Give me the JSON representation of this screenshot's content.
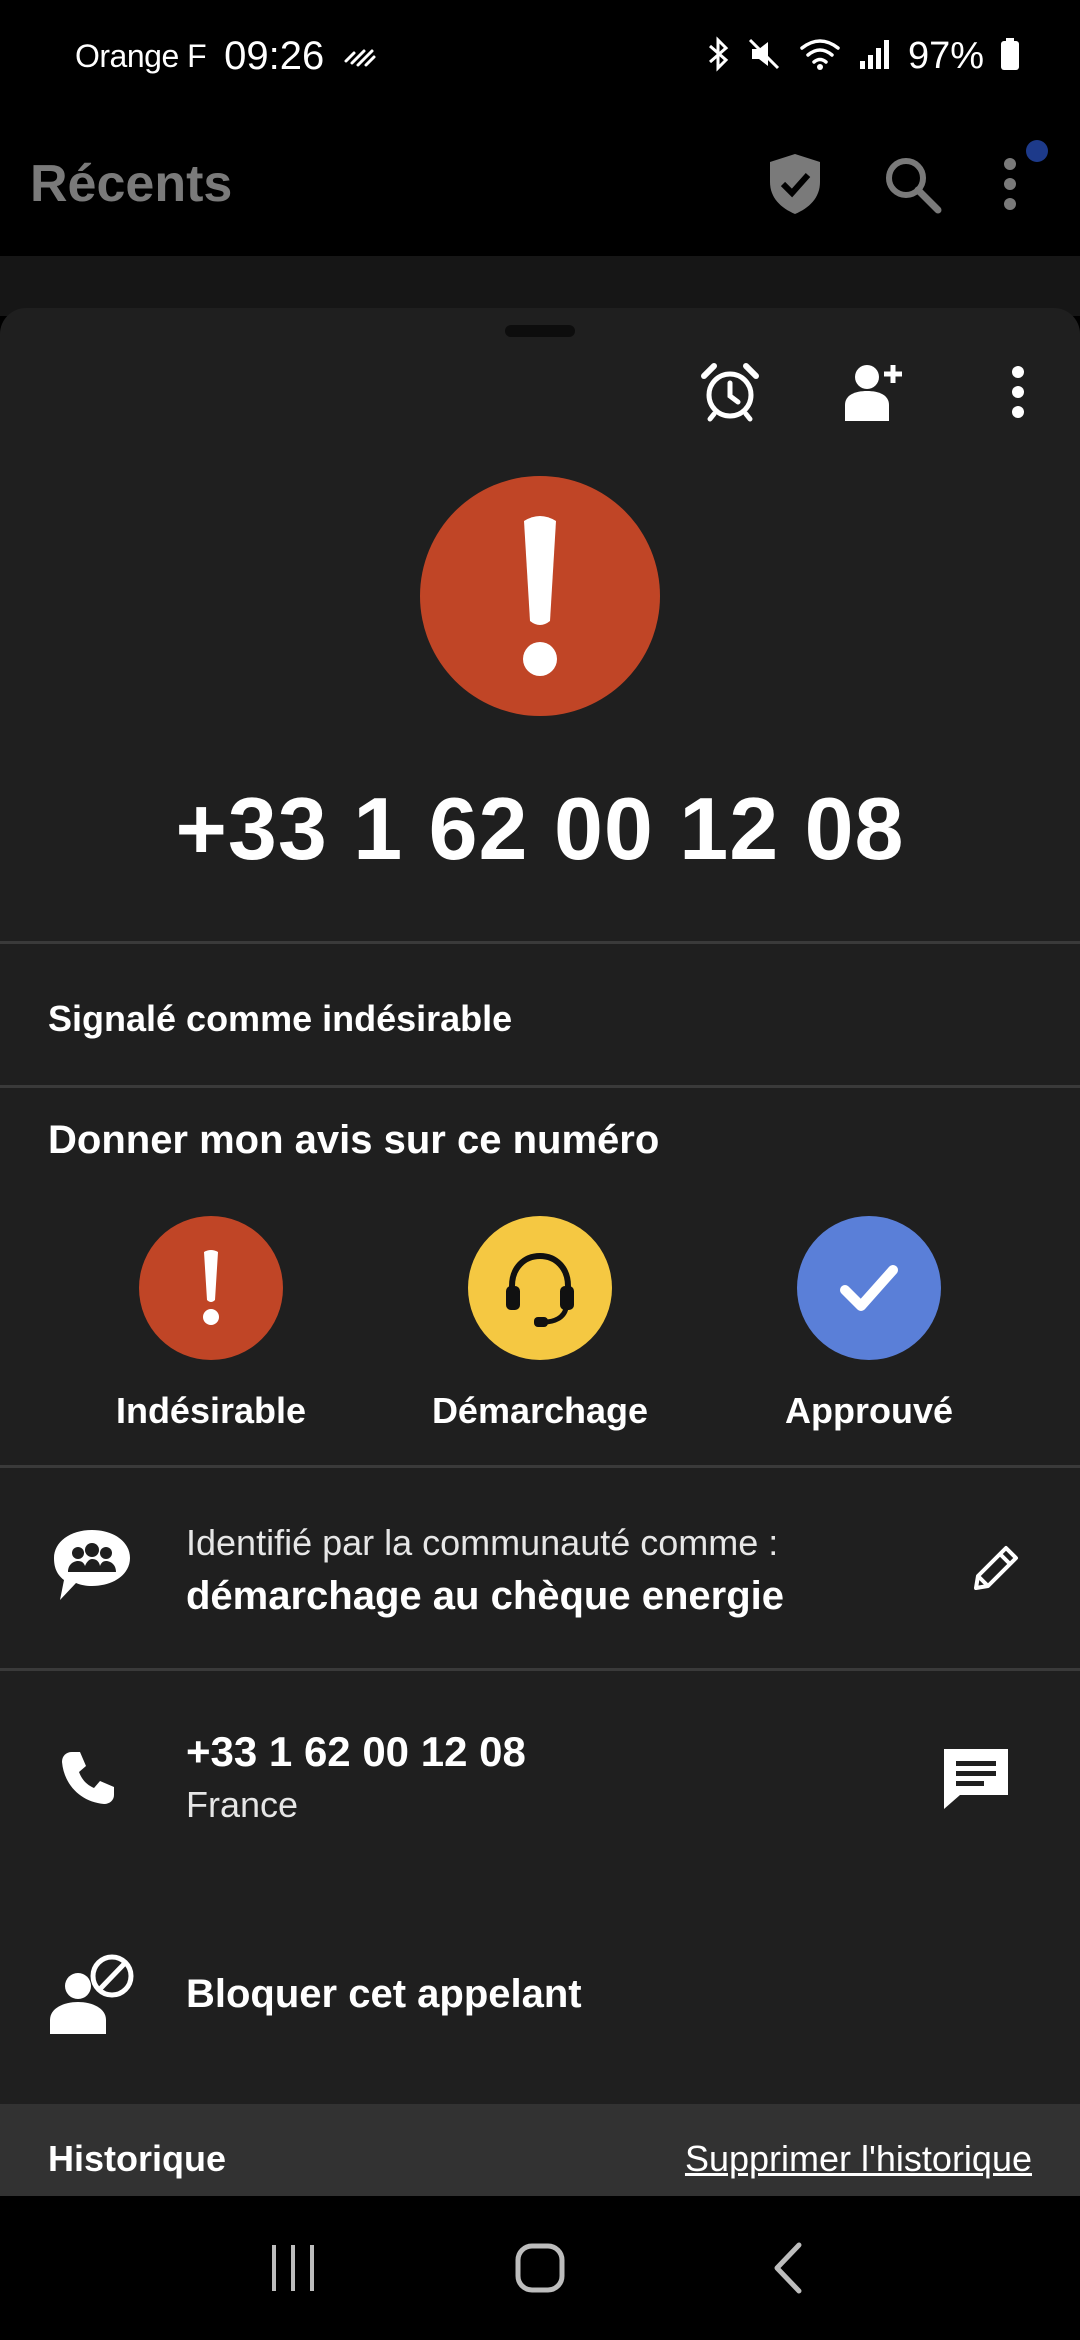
{
  "status_bar": {
    "carrier": "Orange F",
    "time": "09:26",
    "battery_percent": "97%",
    "icons": [
      "nfc-icon",
      "bluetooth-icon",
      "mute-icon",
      "wifi-icon",
      "signal-icon",
      "battery-icon"
    ]
  },
  "app_bar": {
    "title": "Récents",
    "icons": [
      "shield-check-icon",
      "search-icon",
      "more-vert-icon"
    ]
  },
  "sheet": {
    "actions": [
      "alarm-icon",
      "add-contact-icon",
      "more-vert-icon"
    ],
    "alert_color": "#c04526",
    "phone_number": "+33 1 62 00 12 08",
    "reported_text": "Signalé comme indésirable",
    "rate": {
      "title": "Donner mon avis sur ce numéro",
      "options": [
        {
          "label": "Indésirable",
          "color": "#c04526",
          "icon": "exclamation-icon"
        },
        {
          "label": "Démarchage",
          "color": "#f5c842",
          "icon": "headset-icon"
        },
        {
          "label": "Approuvé",
          "color": "#5a7fd8",
          "icon": "check-icon"
        }
      ]
    },
    "community": {
      "line1": "Identifié par la communauté comme :",
      "line2": "démarchage au chèque energie"
    },
    "number_row": {
      "number": "+33 1 62 00 12 08",
      "country": "France"
    },
    "block_label": "Bloquer cet appelant",
    "history": {
      "title": "Historique",
      "clear_label": "Supprimer l'historique"
    }
  },
  "nav_bar": {
    "buttons": [
      "recents-icon",
      "home-icon",
      "back-icon"
    ]
  }
}
